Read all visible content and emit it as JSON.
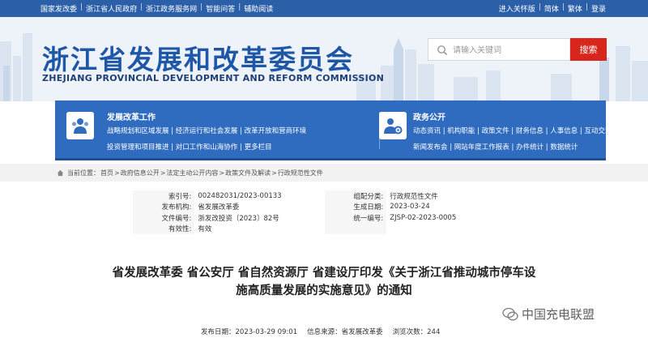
{
  "topbar": {
    "left_links": [
      "国家发改委",
      "浙江省人民政府",
      "浙江政务服务网",
      "智能问答",
      "辅助阅读"
    ],
    "right_links": [
      "进入关怀版",
      "简体",
      "繁体",
      "登录"
    ]
  },
  "header": {
    "title": "浙江省发展和改革委员会",
    "subtitle": "ZHEJIANG PROVINCIAL DEVELOPMENT AND REFORM COMMISSION",
    "search_placeholder": "请输入关键词",
    "search_button": "搜索"
  },
  "nav": {
    "work": {
      "heading": "发展改革工作",
      "row1": [
        "战略规划和区域发展",
        "经济运行和社会发展",
        "改革开放和营商环境"
      ],
      "row2": [
        "投资管理和项目推进",
        "对口工作和山海协作",
        "更多栏目"
      ]
    },
    "affairs": {
      "heading": "政务公开",
      "row1": [
        "动态资讯",
        "机构职能",
        "政策文件",
        "财务信息",
        "人事信息",
        "互动交流"
      ],
      "row2": [
        "新闻发布会",
        "网站年度工作报表",
        "办件统计",
        "数据统计"
      ]
    }
  },
  "breadcrumb": {
    "prefix": "当前位置：",
    "items": [
      "首页",
      "政府信息公开",
      "法定主动公开内容",
      "政策文件及解读",
      "行政规范性文件"
    ]
  },
  "meta": {
    "index_label": "索引号:",
    "index_value": "002482031/2023-00133",
    "category_label": "组配分类:",
    "category_value": "行政规范性文件",
    "issuer_label": "发布机构:",
    "issuer_value": "省发展改革委",
    "date_label": "生成日期:",
    "date_value": "2023-03-24",
    "docno_label": "文件编号:",
    "docno_value": "浙发改投资〔2023〕82号",
    "unified_label": "统一编号:",
    "unified_value": "ZJSP-02-2023-0005",
    "validity_label": "有效性:",
    "validity_value": "有效"
  },
  "article": {
    "title_line1": "省发展改革委 省公安厅 省自然资源厅 省建设厅印发《关于浙江省推动城市停车设",
    "title_line2": "施高质量发展的实施意见》的通知",
    "publish_time": "发布日期：2023-03-29 09:01",
    "source": "信息来源：省发展改革委",
    "views": "浏览次数：244"
  },
  "watermark": {
    "text": "中国充电联盟"
  },
  "colors": {
    "primary": "#2f6cbf",
    "title_blue": "#1e57a8",
    "search_red": "#d9261c",
    "topbar": "#2b5fa8"
  }
}
